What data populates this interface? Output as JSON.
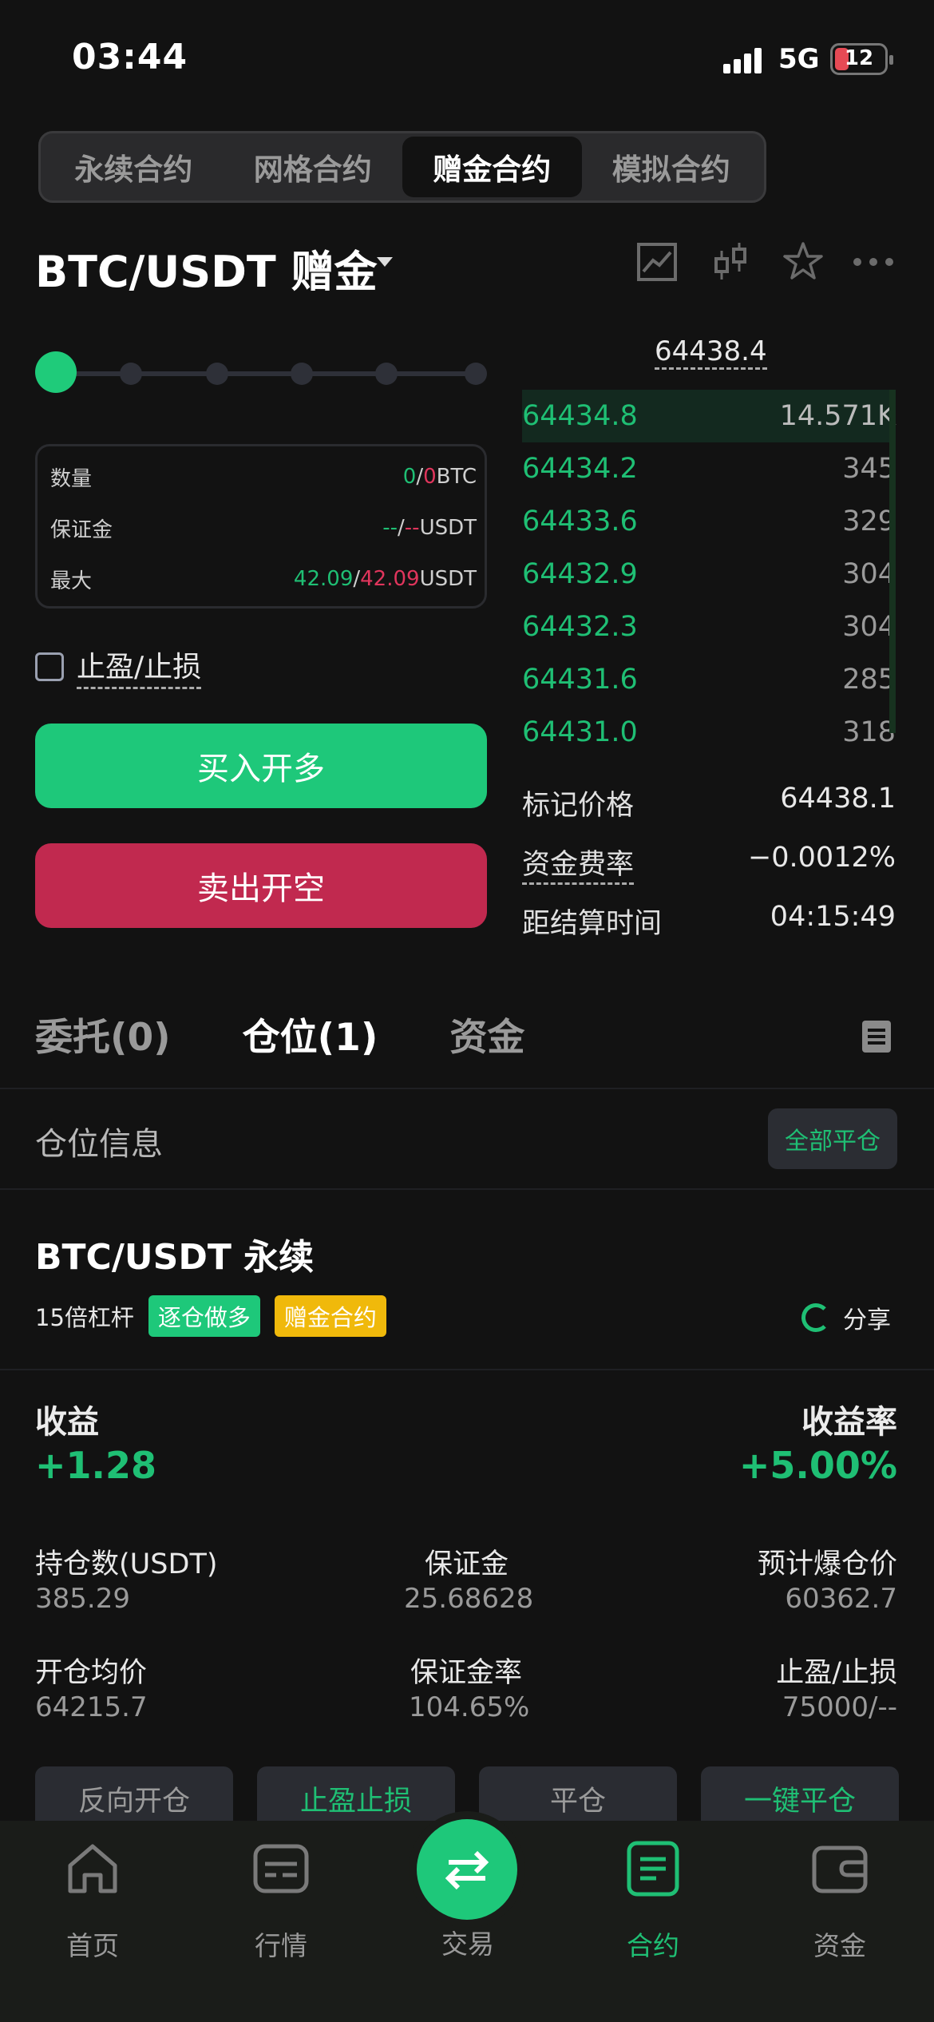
{
  "status_bar": {
    "time": "03:44",
    "network": "5G",
    "battery": "12"
  },
  "contract_tabs": [
    "永续合约",
    "网格合约",
    "赠金合约",
    "模拟合约"
  ],
  "pair": {
    "name": "BTC/USDT 赠金"
  },
  "order_form": {
    "leverage_slider_level": 0,
    "quantity": {
      "label": "数量",
      "green": "0",
      "sep": "/",
      "red": "0",
      "unit": "BTC"
    },
    "margin": {
      "label": "保证金",
      "green": "--",
      "sep": "/",
      "red": "--",
      "unit": "USDT"
    },
    "max": {
      "label": "最大",
      "green": "42.09",
      "sep": "/",
      "red": "42.09",
      "unit": "USDT"
    },
    "tpsl_label": "止盈/止损",
    "buy_label": "买入开多",
    "sell_label": "卖出开空"
  },
  "order_book": {
    "last_price": "64438.4",
    "rows": [
      {
        "price": "64434.8",
        "qty": "14.571K"
      },
      {
        "price": "64434.2",
        "qty": "345"
      },
      {
        "price": "64433.6",
        "qty": "329"
      },
      {
        "price": "64432.9",
        "qty": "304"
      },
      {
        "price": "64432.3",
        "qty": "304"
      },
      {
        "price": "64431.6",
        "qty": "285"
      },
      {
        "price": "64431.0",
        "qty": "318"
      }
    ],
    "mark_price_label": "标记价格",
    "mark_price": "64438.1",
    "funding_rate_label": "资金费率",
    "funding_rate": "−0.0012%",
    "settlement_label": "距结算时间",
    "settlement_time": "04:15:49"
  },
  "section_tabs": [
    "委托(0)",
    "仓位(1)",
    "资金"
  ],
  "position": {
    "info_title": "仓位信息",
    "close_all_label": "全部平仓",
    "pair": "BTC/USDT 永续",
    "leverage": "15倍杠杆",
    "tag_mode": "逐仓做多",
    "tag_type": "赠金合约",
    "share_label": "分享",
    "pnl_label": "收益",
    "pnl_value": "+1.28",
    "roi_label": "收益率",
    "roi_value": "+5.00%",
    "stats": [
      {
        "label": "持仓数(USDT)",
        "value": "385.29"
      },
      {
        "label": "保证金",
        "value": "25.68628"
      },
      {
        "label": "预计爆仓价",
        "value": "60362.7"
      },
      {
        "label": "开仓均价",
        "value": "64215.7"
      },
      {
        "label": "保证金率",
        "value": "104.65%"
      },
      {
        "label": "止盈/止损",
        "value": "75000/--"
      }
    ],
    "actions": [
      "反向开仓",
      "止盈止损",
      "平仓",
      "一键平仓"
    ]
  },
  "bottom_nav": [
    "首页",
    "行情",
    "交易",
    "合约",
    "资金"
  ],
  "colors": {
    "green": "#1fbf74",
    "red": "#c1294f",
    "yellow": "#f0b90b",
    "bg": "#121212"
  }
}
